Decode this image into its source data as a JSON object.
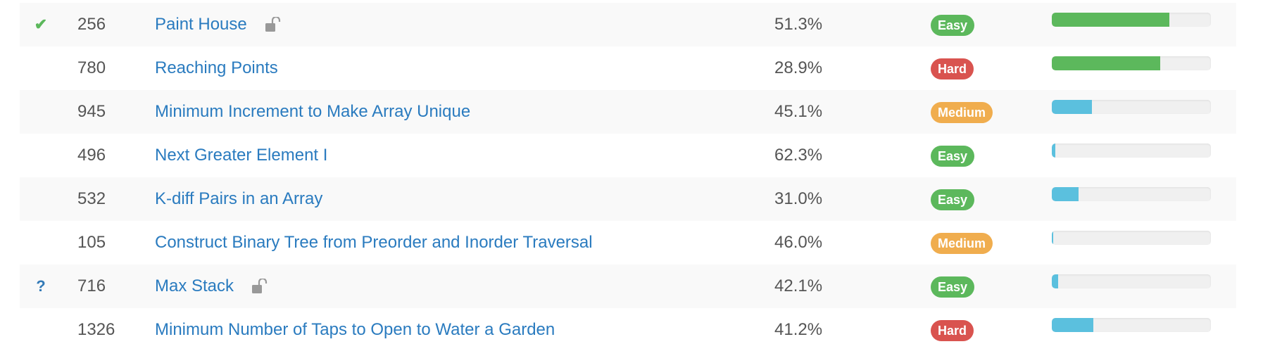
{
  "problems": [
    {
      "status": "solved",
      "status_glyph": "✔",
      "id": "256",
      "title": "Paint House",
      "locked": true,
      "acceptance": "51.3%",
      "difficulty": "Easy",
      "difficulty_class": "easy",
      "frequency": 0.74,
      "frequency_color": "green"
    },
    {
      "status": "none",
      "status_glyph": "",
      "id": "780",
      "title": "Reaching Points",
      "locked": false,
      "acceptance": "28.9%",
      "difficulty": "Hard",
      "difficulty_class": "hard",
      "frequency": 0.68,
      "frequency_color": "green"
    },
    {
      "status": "none",
      "status_glyph": "",
      "id": "945",
      "title": "Minimum Increment to Make Array Unique",
      "locked": false,
      "acceptance": "45.1%",
      "difficulty": "Medium",
      "difficulty_class": "medium",
      "frequency": 0.25,
      "frequency_color": "blue"
    },
    {
      "status": "none",
      "status_glyph": "",
      "id": "496",
      "title": "Next Greater Element I",
      "locked": false,
      "acceptance": "62.3%",
      "difficulty": "Easy",
      "difficulty_class": "easy",
      "frequency": 0.02,
      "frequency_color": "blue"
    },
    {
      "status": "none",
      "status_glyph": "",
      "id": "532",
      "title": "K-diff Pairs in an Array",
      "locked": false,
      "acceptance": "31.0%",
      "difficulty": "Easy",
      "difficulty_class": "easy",
      "frequency": 0.17,
      "frequency_color": "blue"
    },
    {
      "status": "none",
      "status_glyph": "",
      "id": "105",
      "title": "Construct Binary Tree from Preorder and Inorder Traversal",
      "locked": false,
      "acceptance": "46.0%",
      "difficulty": "Medium",
      "difficulty_class": "medium",
      "frequency": 0.01,
      "frequency_color": "blue"
    },
    {
      "status": "attempted",
      "status_glyph": "?",
      "id": "716",
      "title": "Max Stack",
      "locked": true,
      "acceptance": "42.1%",
      "difficulty": "Easy",
      "difficulty_class": "easy",
      "frequency": 0.04,
      "frequency_color": "blue"
    },
    {
      "status": "none",
      "status_glyph": "",
      "id": "1326",
      "title": "Minimum Number of Taps to Open to Water a Garden",
      "locked": false,
      "acceptance": "41.2%",
      "difficulty": "Hard",
      "difficulty_class": "hard",
      "frequency": 0.26,
      "frequency_color": "blue"
    }
  ]
}
